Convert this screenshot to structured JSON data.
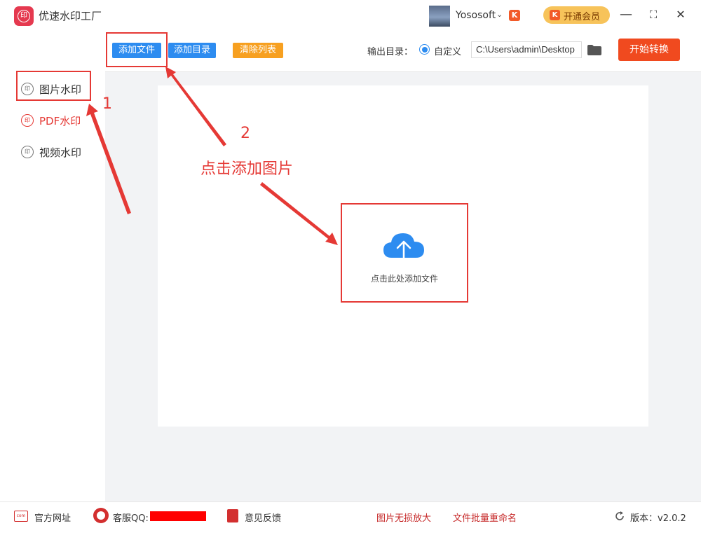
{
  "app": {
    "title": "优速水印工厂",
    "logo_glyph": "印"
  },
  "user": {
    "name": "Yososoft",
    "vip_mini_glyph": "K"
  },
  "header": {
    "vip_button_label": "开通会员",
    "vip_glyph": "K",
    "minimize": "—",
    "maximize": "⛶",
    "close": "✕"
  },
  "sidebar": {
    "items": [
      {
        "label": "图片水印",
        "icon": "印"
      },
      {
        "label": "PDF水印",
        "icon": "印"
      },
      {
        "label": "视频水印",
        "icon": "印"
      }
    ]
  },
  "toolbar": {
    "add_file": "添加文件",
    "add_dir": "添加目录",
    "clear_list": "清除列表",
    "output_label": "输出目录：",
    "radio_label": "自定义",
    "output_path": "C:\\Users\\admin\\Desktop",
    "start": "开始转换"
  },
  "drop": {
    "label": "点击此处添加文件"
  },
  "annotations": {
    "num1": "1",
    "num2": "2",
    "hint": "点击添加图片"
  },
  "footer": {
    "web_icon_text": "com",
    "website": "官方网址",
    "qq": "客服QQ:",
    "feedback": "意见反馈",
    "link1": "图片无损放大",
    "link2": "文件批量重命名",
    "version": "版本：v2.0.2"
  },
  "colors": {
    "accent_blue": "#2d8cf0",
    "orange": "#f7a020",
    "start_red": "#f04a1f",
    "annotation_red": "#e53935",
    "logo_red": "#e5394f"
  }
}
